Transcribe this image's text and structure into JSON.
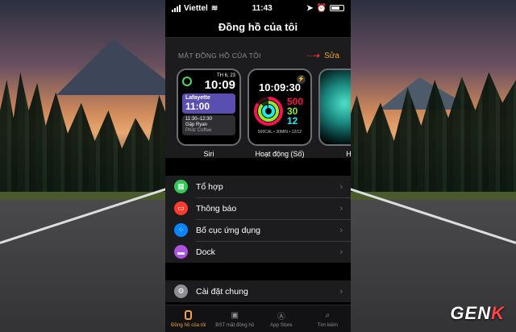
{
  "status": {
    "carrier": "Viettel",
    "time": "11:43"
  },
  "title": "Đồng hồ của tôi",
  "section_label": "MẶT ĐỒNG HỒ CỦA TÔI",
  "edit_label": "Sửa",
  "faces": [
    {
      "name": "Siri",
      "date": "TH 6, 23",
      "time": "10:09",
      "card_name": "Lafayette",
      "card_time": "11:00",
      "event_time": "11:30–12:30",
      "event_title": "Gặp Ryan",
      "event_place": "Philz Coffee"
    },
    {
      "name": "Hoạt động (Số)",
      "time": "10:09:30",
      "move": "500",
      "exercise": "30",
      "stand": "12",
      "footer": "500CAL • 30MIN • 12/12"
    },
    {
      "name": "Hồ"
    }
  ],
  "menu": [
    {
      "label": "Tổ hợp",
      "icon": "grid-icon",
      "color": "#34c759"
    },
    {
      "label": "Thông báo",
      "icon": "calendar-icon",
      "color": "#ff3b30"
    },
    {
      "label": "Bố cục ứng dụng",
      "icon": "app-layout-icon",
      "color": "#0a84ff"
    },
    {
      "label": "Dock",
      "icon": "dock-icon",
      "color": "#af52de"
    }
  ],
  "settings": {
    "label": "Cài đặt chung",
    "icon": "gear-icon",
    "color": "#8e8e93"
  },
  "tabs": [
    {
      "label": "Đồng hồ của tôi",
      "icon": "watch-icon",
      "active": true
    },
    {
      "label": "BST mặt đồng hồ",
      "icon": "face-gallery-icon",
      "active": false
    },
    {
      "label": "App Store",
      "icon": "app-store-icon",
      "active": false
    },
    {
      "label": "Tìm kiếm",
      "icon": "search-icon",
      "active": false
    }
  ],
  "logo": {
    "main": "GEN",
    "accent": "K"
  }
}
